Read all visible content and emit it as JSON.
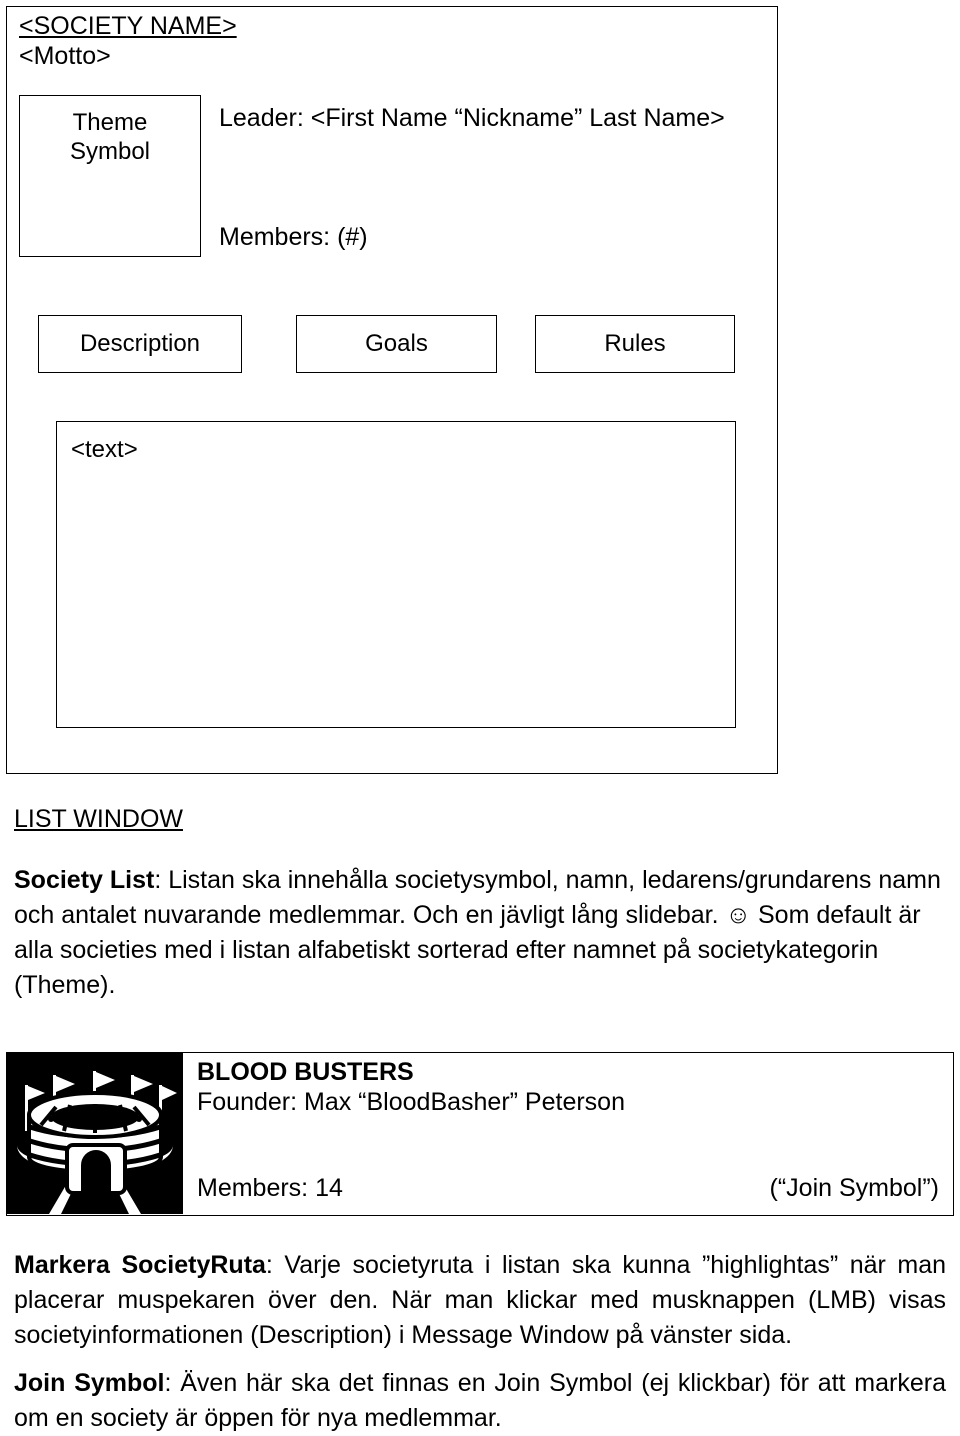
{
  "society_window": {
    "society_name": "<SOCIETY NAME>",
    "motto": "<Motto>",
    "theme_symbol_label_line1": "Theme",
    "theme_symbol_label_line2": "Symbol",
    "leader": "Leader: <First Name “Nickname” Last Name>",
    "members": "Members: (#)",
    "tabs": [
      {
        "label": "Description"
      },
      {
        "label": "Goals"
      },
      {
        "label": "Rules"
      }
    ],
    "text_area_placeholder": "<text>"
  },
  "list_window": {
    "heading": "LIST WINDOW",
    "society_list_label": "Society List",
    "society_list_body": ": Listan ska innehålla societysymbol, namn, ledarens/grundarens namn och antalet nuvarande medlemmar. Och en jävligt lång slidebar. ☺ Som default är alla societies med i listan alfabetiskt sorterad efter namnet på societykategorin (Theme).",
    "society_row": {
      "icon_name": "stadium-icon",
      "title": "BLOOD BUSTERS",
      "founder": "Founder: Max “BloodBasher” Peterson",
      "members": "Members: 14",
      "join_symbol": "(“Join Symbol”)"
    },
    "markera_label": "Markera SocietyRuta",
    "markera_body": ": Varje societyruta i listan ska kunna ”highlightas” när man placerar muspekaren över den. När man klickar med musknappen (LMB) visas societyinformationen (Description) i Message Window på vänster sida.",
    "join_label": "Join Symbol",
    "join_body": ": Även här ska det finnas en Join Symbol (ej klickbar) för att markera om en society är öppen för nya medlemmar."
  },
  "colors": {
    "ink": "#000000",
    "paper": "#ffffff"
  }
}
